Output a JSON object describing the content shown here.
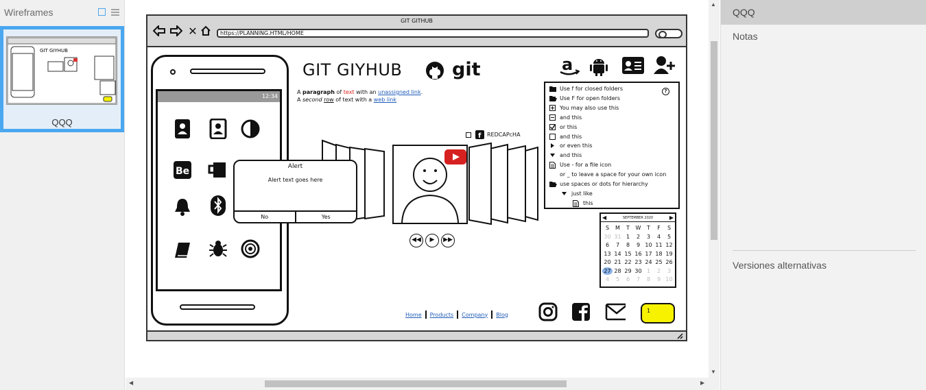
{
  "left_panel": {
    "title": "Wireframes",
    "thumbnail": {
      "label": "QQQ"
    }
  },
  "right_panel": {
    "header": "QQQ",
    "notes_label": "Notas",
    "alternatives_label": "Versiones alternativas"
  },
  "wireframe": {
    "browser_title": "GIT GITHUB",
    "url": "https://PLANNING.HTML/HOME",
    "site_title": "GIT GIYHUB",
    "git_word": "git",
    "paragraph": {
      "line1_a": "A ",
      "line1_bold": "paragraph",
      "line1_b": " of ",
      "line1_red": "text",
      "line1_c": " with an ",
      "line1_link": "unassigned link",
      "line1_d": ".",
      "line2_a": "A ",
      "line2_it": "second",
      "line2_b": " ",
      "line2_u": "row",
      "line2_c": " of text with a ",
      "line2_link": "web link"
    },
    "status_time": "12:34",
    "alert": {
      "title": "Alert",
      "text": "Alert text goes here",
      "no": "No",
      "yes": "Yes"
    },
    "captcha": "REDCAPcHA",
    "tree": [
      {
        "icon": "folder-closed-icon",
        "label": "Use f for closed folders",
        "indent": 0
      },
      {
        "icon": "folder-open-icon",
        "label": "Use F for open folders",
        "indent": 0
      },
      {
        "icon": "plus-box-icon",
        "label": "You may also use this",
        "indent": 0
      },
      {
        "icon": "minus-box-icon",
        "label": "and this",
        "indent": 0
      },
      {
        "icon": "checked-box-icon",
        "label": "or this",
        "indent": 0
      },
      {
        "icon": "empty-box-icon",
        "label": "and this",
        "indent": 0
      },
      {
        "icon": "triangle-right-icon",
        "label": "or even this",
        "indent": 0
      },
      {
        "icon": "triangle-down-icon",
        "label": "and this",
        "indent": 0
      },
      {
        "icon": "file-icon",
        "label": "Use - for a file icon",
        "indent": 0
      },
      {
        "icon": "blank-icon",
        "label": "or _ to leave a space for your own icon",
        "indent": 0
      },
      {
        "icon": "folder-open-icon",
        "label": "use spaces or dots for hierarchy",
        "indent": 0
      },
      {
        "icon": "triangle-down-icon",
        "label": "just like",
        "indent": 1
      },
      {
        "icon": "file-icon",
        "label": "this",
        "indent": 2
      }
    ],
    "calendar": {
      "month": "SEPTEMBER 2020",
      "weekdays": [
        "S",
        "M",
        "T",
        "W",
        "T",
        "F",
        "S"
      ],
      "days": [
        {
          "d": "30",
          "dim": true
        },
        {
          "d": "31",
          "dim": true
        },
        {
          "d": "1"
        },
        {
          "d": "2"
        },
        {
          "d": "3"
        },
        {
          "d": "4"
        },
        {
          "d": "5"
        },
        {
          "d": "6"
        },
        {
          "d": "7"
        },
        {
          "d": "8"
        },
        {
          "d": "9"
        },
        {
          "d": "10"
        },
        {
          "d": "11"
        },
        {
          "d": "12"
        },
        {
          "d": "13"
        },
        {
          "d": "14"
        },
        {
          "d": "15"
        },
        {
          "d": "16"
        },
        {
          "d": "17"
        },
        {
          "d": "18"
        },
        {
          "d": "19"
        },
        {
          "d": "20"
        },
        {
          "d": "21"
        },
        {
          "d": "22"
        },
        {
          "d": "23"
        },
        {
          "d": "24"
        },
        {
          "d": "25"
        },
        {
          "d": "26"
        },
        {
          "d": "27",
          "sel": true
        },
        {
          "d": "28"
        },
        {
          "d": "29"
        },
        {
          "d": "30"
        },
        {
          "d": "1",
          "dim": true
        },
        {
          "d": "2",
          "dim": true
        },
        {
          "d": "3",
          "dim": true
        },
        {
          "d": "4",
          "dim": true
        },
        {
          "d": "5",
          "dim": true
        },
        {
          "d": "6",
          "dim": true
        },
        {
          "d": "7",
          "dim": true
        },
        {
          "d": "8",
          "dim": true
        },
        {
          "d": "9",
          "dim": true
        },
        {
          "d": "10",
          "dim": true
        }
      ]
    },
    "links": [
      "Home",
      "Products",
      "Company",
      "Blog"
    ],
    "yellow_button": "1"
  }
}
